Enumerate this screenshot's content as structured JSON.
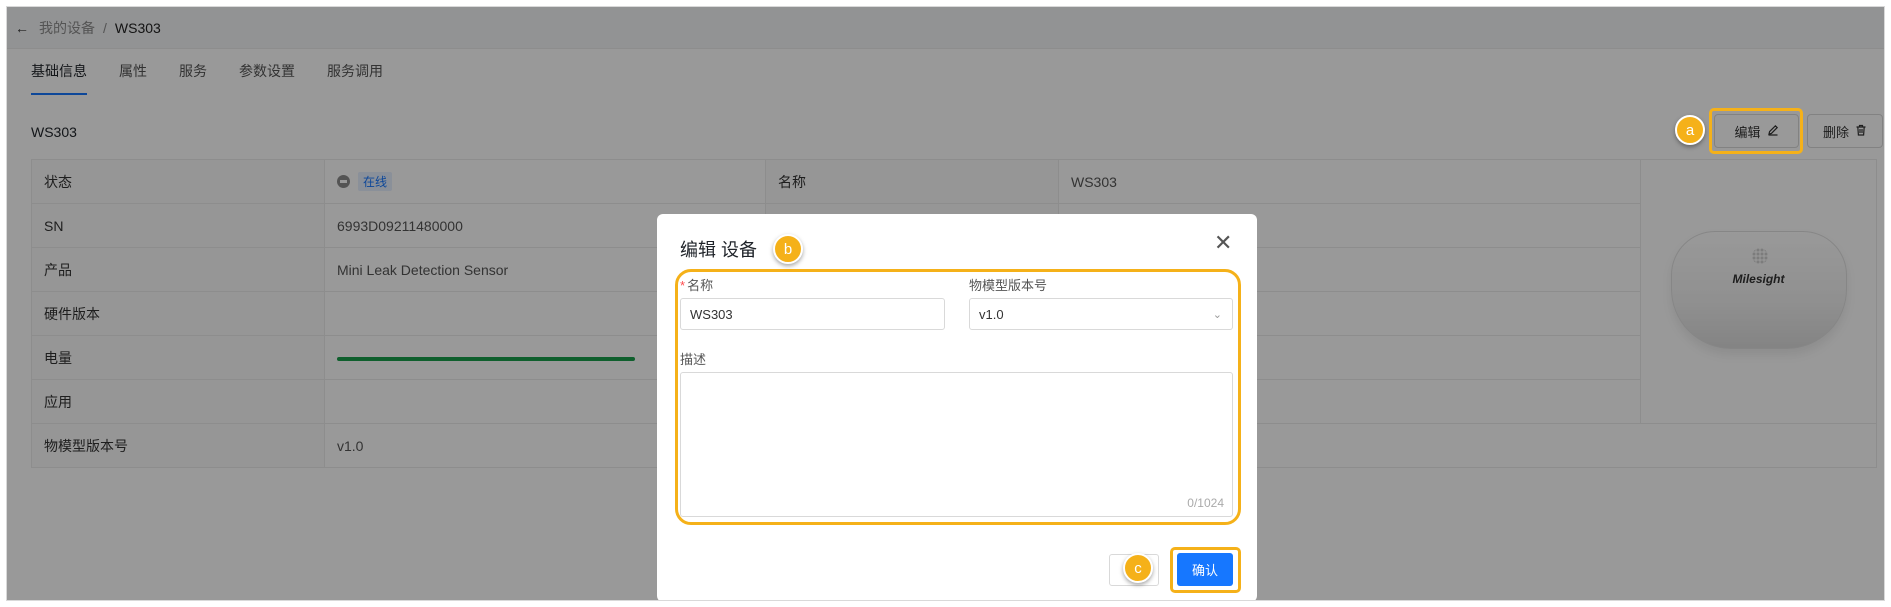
{
  "breadcrumb": {
    "back_icon": "arrow-left-icon",
    "parent": "我的设备",
    "separator": "/",
    "current": "WS303"
  },
  "tabs": [
    {
      "label": "基础信息",
      "active": true
    },
    {
      "label": "属性",
      "active": false
    },
    {
      "label": "服务",
      "active": false
    },
    {
      "label": "参数设置",
      "active": false
    },
    {
      "label": "服务调用",
      "active": false
    }
  ],
  "device_title": "WS303",
  "actions": {
    "edit_label": "编辑",
    "edit_icon": "pencil-icon",
    "delete_label": "删除",
    "delete_icon": "trash-icon"
  },
  "info": {
    "status_label": "状态",
    "status_value": "在线",
    "name_label": "名称",
    "name_value": "WS303",
    "sn_label": "SN",
    "sn_value": "6993D09211480000",
    "product_label": "产品",
    "product_value": "Mini Leak Detection Sensor",
    "hw_label": "硬件版本",
    "battery_label": "电量",
    "battery_level": 1.0,
    "app_label": "应用",
    "model_label": "物模型版本号",
    "model_value": "v1.0"
  },
  "device_image": {
    "brand": "Milesight"
  },
  "modal": {
    "title": "编辑 设备",
    "close_icon": "close-icon",
    "name_required_mark": "*",
    "name_label": "名称",
    "name_value": "WS303",
    "version_label": "物模型版本号",
    "version_value": "v1.0",
    "version_arrow": "⌄",
    "desc_label": "描述",
    "desc_counter": "0/1024",
    "confirm_label": "确认"
  },
  "annotations": {
    "a": "a",
    "b": "b",
    "c": "c"
  },
  "colors": {
    "accent": "#1677ff",
    "highlight": "#f5b119",
    "battery": "#1a9e4b"
  }
}
